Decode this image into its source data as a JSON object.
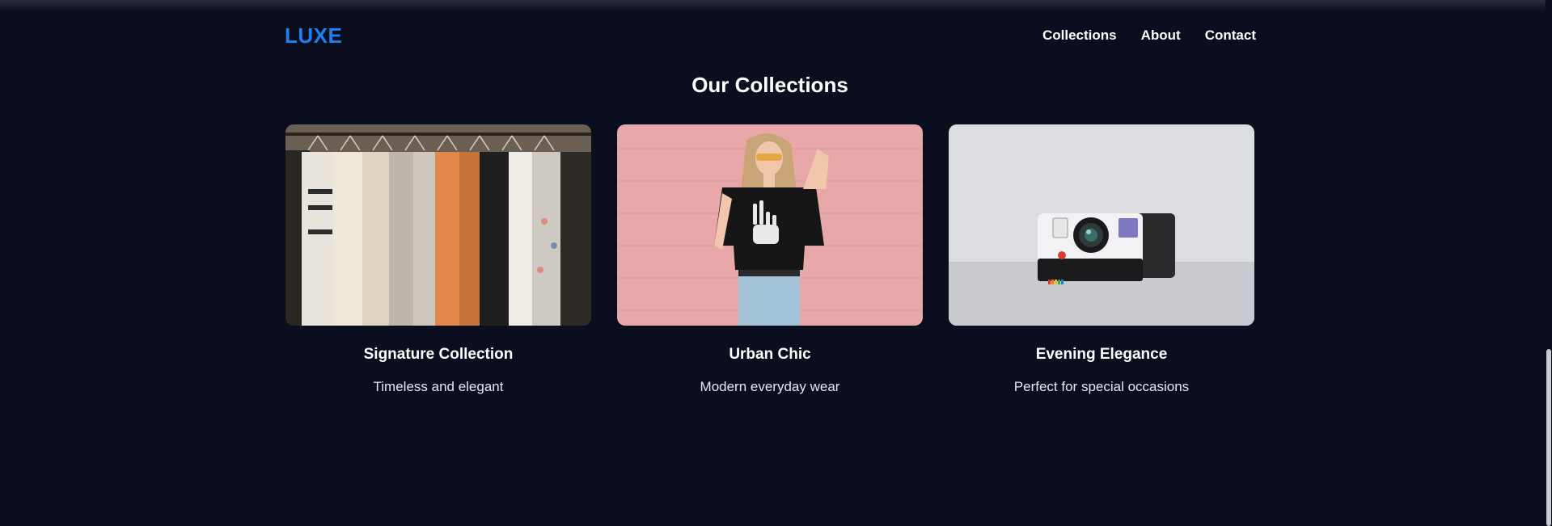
{
  "brand": {
    "name": "LUXE",
    "accent_color": "#1e7ff0"
  },
  "nav": {
    "links": [
      {
        "label": "Collections"
      },
      {
        "label": "About"
      },
      {
        "label": "Contact"
      }
    ]
  },
  "section": {
    "title": "Our Collections"
  },
  "collections": [
    {
      "title": "Signature Collection",
      "subtitle": "Timeless and elegant",
      "image": "clothing-rack-photo"
    },
    {
      "title": "Urban Chic",
      "subtitle": "Modern everyday wear",
      "image": "woman-pink-wall-photo"
    },
    {
      "title": "Evening Elegance",
      "subtitle": "Perfect for special occasions",
      "image": "instant-camera-photo"
    }
  ],
  "colors": {
    "background": "#0a0e1e",
    "text": "#ffffff"
  }
}
